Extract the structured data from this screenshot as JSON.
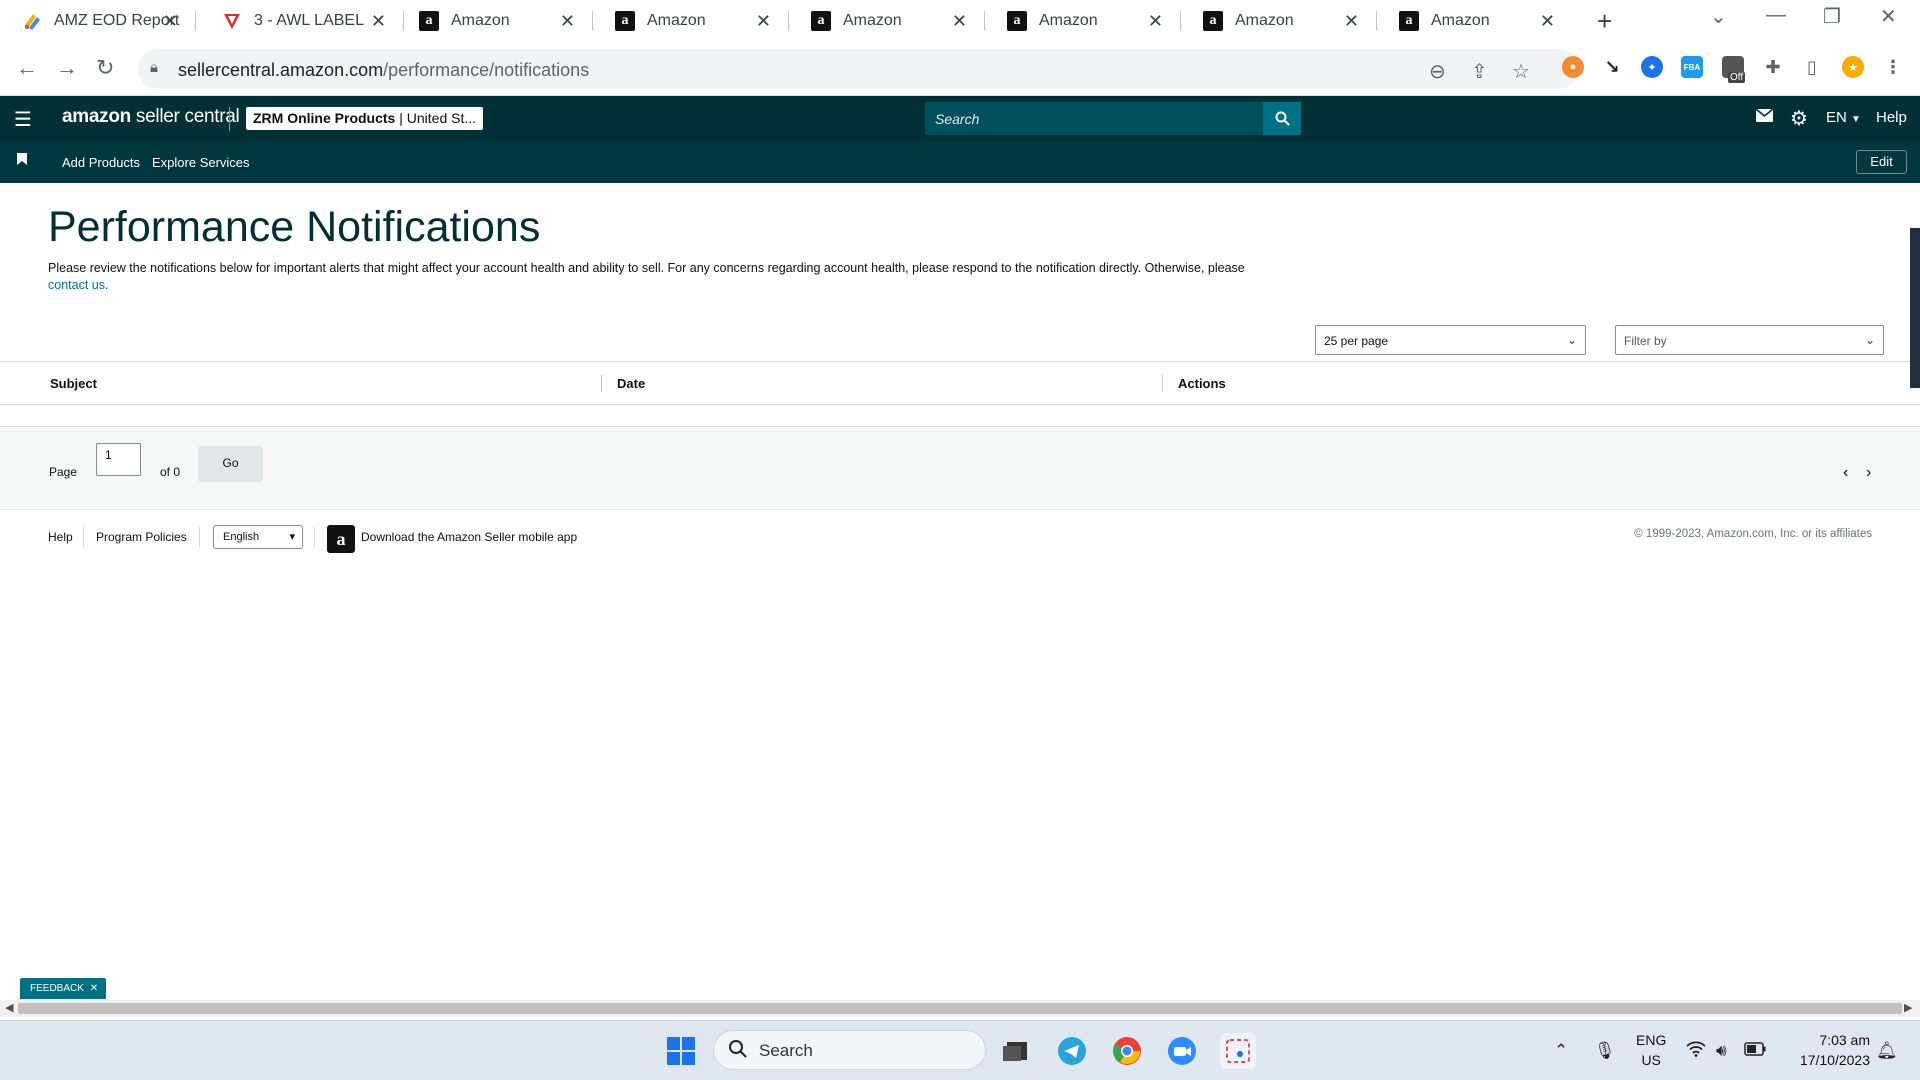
{
  "browser": {
    "tabs": [
      {
        "title": "AMZ EOD Report",
        "icon": "google-sheets-icon"
      },
      {
        "title": "3 - AWL LABEL",
        "icon": "red-v-icon"
      },
      {
        "title": "Amazon",
        "icon": "amazon-icon"
      },
      {
        "title": "Amazon",
        "icon": "amazon-icon"
      },
      {
        "title": "Amazon",
        "icon": "amazon-icon"
      },
      {
        "title": "Amazon",
        "icon": "amazon-icon"
      },
      {
        "title": "Amazon",
        "icon": "amazon-icon"
      },
      {
        "title": "Amazon",
        "icon": "amazon-icon",
        "active": true
      }
    ],
    "url_host": "sellercentral.amazon.com",
    "url_path": "/performance/notifications",
    "extension_badge": "Off"
  },
  "topnav": {
    "logo_brand": "amazon",
    "logo_product": " seller central",
    "account_name": "ZRM Online Products",
    "account_market": " | United St...",
    "search_placeholder": "Search",
    "language": "EN",
    "help": "Help"
  },
  "subnav": {
    "links": [
      "Add Products",
      "Explore Services"
    ],
    "edit": "Edit"
  },
  "main": {
    "title": "Performance Notifications",
    "description": "Please review the notifications below for important alerts that might affect your account health and ability to sell. For any concerns regarding account health, please respond to the notification directly. Otherwise, please",
    "contact_link": "contact us",
    "per_page": "25 per page",
    "filter_placeholder": "Filter by",
    "columns": [
      "Subject",
      "Date",
      "Actions"
    ],
    "rows": []
  },
  "pager": {
    "page_label": "Page",
    "page_value": "1",
    "of_label": "of 0",
    "go": "Go"
  },
  "footer": {
    "help": "Help",
    "program_policies": "Program Policies",
    "language": "English",
    "app_text": "Download the Amazon Seller mobile app",
    "copyright": "© 1999-2023, Amazon.com, Inc. or its affiliates"
  },
  "feedback": {
    "label": "FEEDBACK"
  },
  "taskbar": {
    "search": "Search",
    "lang_top": "ENG",
    "lang_bottom": "US",
    "time": "7:03 am",
    "date": "17/10/2023"
  },
  "colors": {
    "nav_bg": "#002f36",
    "subnav_bg": "#00363e",
    "accent": "#007185",
    "title": "#002f36"
  }
}
